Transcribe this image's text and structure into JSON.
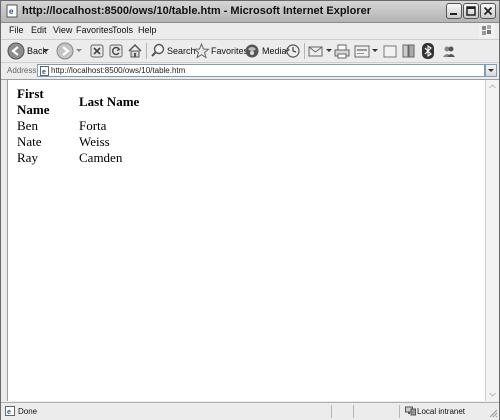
{
  "window": {
    "title": "http://localhost:8500/ows/10/table.htm - Microsoft Internet Explorer"
  },
  "menu": [
    "File",
    "Edit",
    "View",
    "Favorites",
    "Tools",
    "Help"
  ],
  "toolbar": {
    "back_label": "Back",
    "search_label": "Search",
    "favorites_label": "Favorites",
    "media_label": "Media"
  },
  "address": {
    "label": "Address",
    "url": "http://localhost:8500/ows/10/table.htm"
  },
  "table": {
    "headers": [
      "First Name",
      "Last Name"
    ],
    "rows": [
      [
        "Ben",
        "Forta"
      ],
      [
        "Nate",
        "Weiss"
      ],
      [
        "Ray",
        "Camden"
      ]
    ]
  },
  "status": {
    "text": "Done",
    "zone": "Local intranet"
  }
}
